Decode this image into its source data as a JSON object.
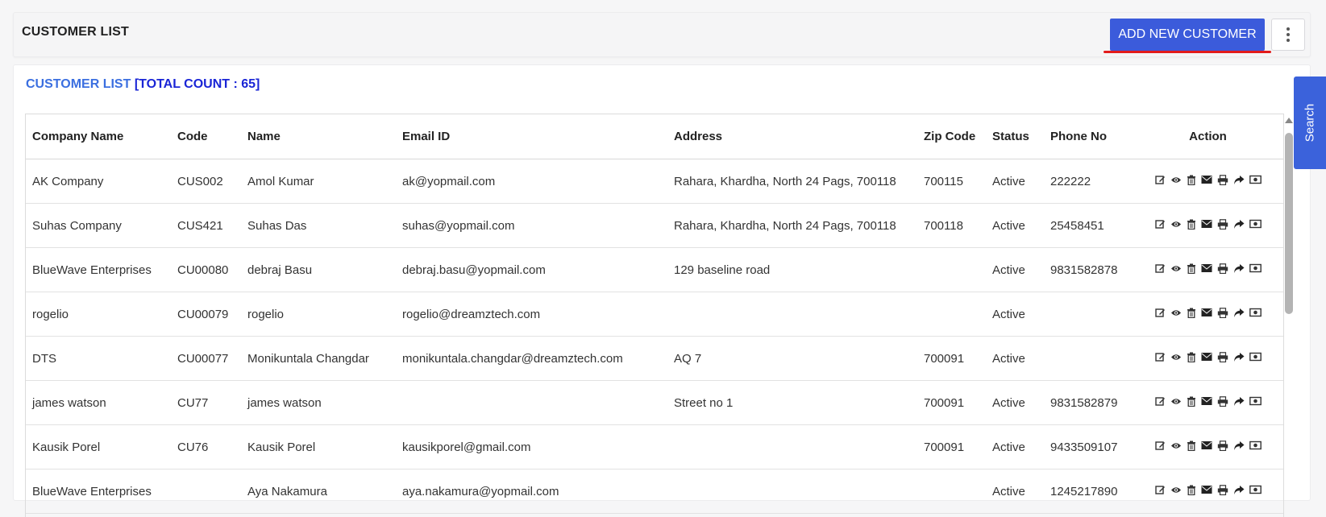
{
  "header": {
    "title": "CUSTOMER LIST",
    "add_button": "ADD NEW CUSTOMER"
  },
  "list": {
    "heading": "CUSTOMER LIST",
    "count_label": "[TOTAL COUNT : 65]"
  },
  "table": {
    "columns": [
      "Company Name",
      "Code",
      "Name",
      "Email ID",
      "Address",
      "Zip Code",
      "Status",
      "Phone No",
      "Action"
    ],
    "rows": [
      {
        "company": "AK Company",
        "code": "CUS002",
        "name": "Amol Kumar",
        "email": "ak@yopmail.com",
        "address": "Rahara, Khardha, North 24 Pags, 700118",
        "zip": "700115",
        "status": "Active",
        "phone": "222222"
      },
      {
        "company": "Suhas Company",
        "code": "CUS421",
        "name": "Suhas Das",
        "email": "suhas@yopmail.com",
        "address": "Rahara, Khardha, North 24 Pags, 700118",
        "zip": "700118",
        "status": "Active",
        "phone": "25458451"
      },
      {
        "company": "BlueWave Enterprises",
        "code": "CU00080",
        "name": "debraj Basu",
        "email": "debraj.basu@yopmail.com",
        "address": "129 baseline road",
        "zip": "",
        "status": "Active",
        "phone": "9831582878"
      },
      {
        "company": "rogelio",
        "code": "CU00079",
        "name": "rogelio",
        "email": "rogelio@dreamztech.com",
        "address": "",
        "zip": "",
        "status": "Active",
        "phone": ""
      },
      {
        "company": "DTS",
        "code": "CU00077",
        "name": "Monikuntala Changdar",
        "email": "monikuntala.changdar@dreamztech.com",
        "address": "AQ 7",
        "zip": "700091",
        "status": "Active",
        "phone": ""
      },
      {
        "company": "james watson",
        "code": "CU77",
        "name": "james watson",
        "email": "",
        "address": "Street no 1",
        "zip": "700091",
        "status": "Active",
        "phone": "9831582879"
      },
      {
        "company": "Kausik Porel",
        "code": "CU76",
        "name": "Kausik Porel",
        "email": "kausikporel@gmail.com",
        "address": "",
        "zip": "700091",
        "status": "Active",
        "phone": "9433509107"
      },
      {
        "company": "BlueWave Enterprises",
        "code": "",
        "name": "Aya Nakamura",
        "email": "aya.nakamura@yopmail.com",
        "address": "",
        "zip": "",
        "status": "Active",
        "phone": "1245217890"
      }
    ],
    "actions": [
      "edit-icon",
      "view-icon",
      "delete-icon",
      "email-icon",
      "print-icon",
      "share-icon",
      "payment-icon"
    ]
  },
  "search_tab": {
    "label": "Search"
  },
  "colors": {
    "primary_button": "#3b5bdb",
    "heading_blue": "#3b6fe0",
    "count_blue": "#1a25d6",
    "underline_red": "#e21b1b"
  }
}
